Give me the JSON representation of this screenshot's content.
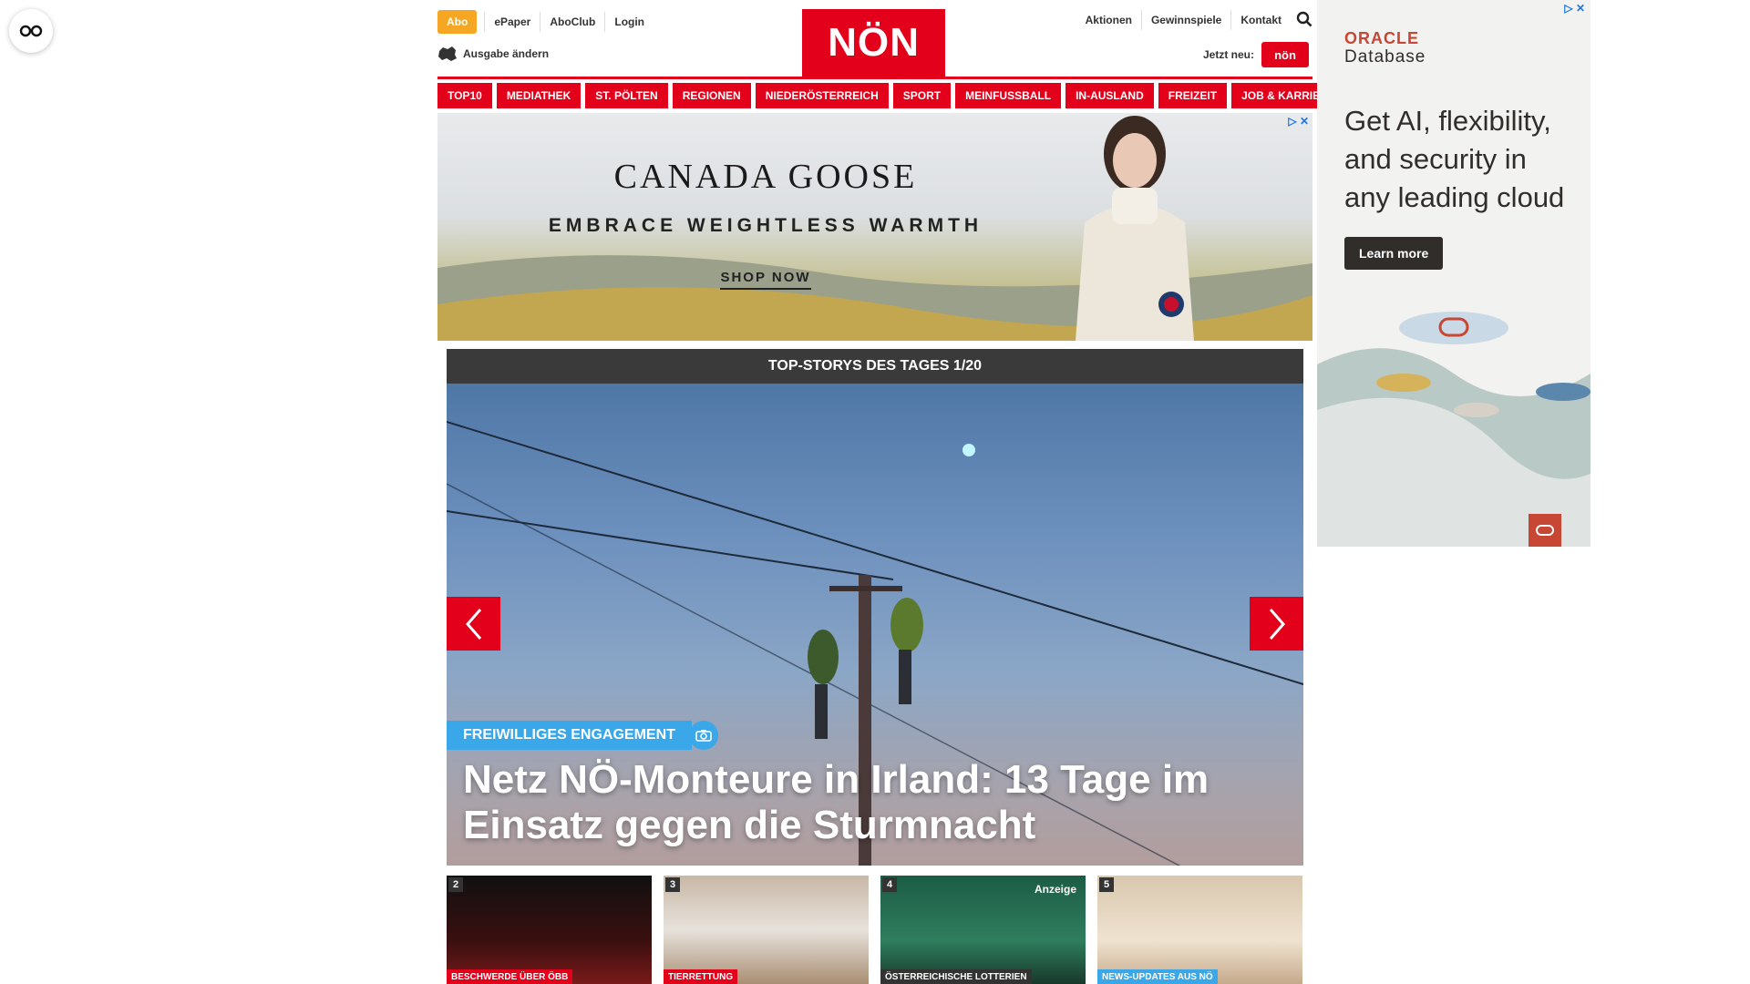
{
  "topbar": {
    "abo": "Abo",
    "links_left": [
      "ePaper",
      "AboClub",
      "Login"
    ],
    "edition": "Ausgabe ändern",
    "logo": "NÖN",
    "links_right": [
      "Aktionen",
      "Gewinnspiele",
      "Kontakt"
    ],
    "new_label": "Jetzt neu:",
    "new_badge": "nön"
  },
  "nav": [
    "TOP10",
    "MEDIATHEK",
    "ST. PÖLTEN",
    "REGIONEN",
    "NIEDERÖSTERREICH",
    "SPORT",
    "MEINFUSSBALL",
    "IN-AUSLAND",
    "FREIZEIT",
    "JOB & KARRIERE"
  ],
  "ad_banner": {
    "brand": "CANADA GOOSE",
    "tagline": "EMBRACE WEIGHTLESS WARMTH",
    "cta": "SHOP NOW"
  },
  "stories": {
    "header": "TOP-STORYS DES TAGES 1/20",
    "category": "FREIWILLIGES ENGAGEMENT",
    "title": "Netz NÖ-Monteure in Irland: 13 Tage im Einsatz gegen die Sturmnacht"
  },
  "thumbs": [
    {
      "num": "2",
      "tag": "BESCHWERDE ÜBER ÖBB",
      "tag_color": "#e2001a"
    },
    {
      "num": "3",
      "tag": "TIERRETTUNG",
      "tag_color": "#e2001a"
    },
    {
      "num": "4",
      "tag": "ÖSTERREICHISCHE LOTTERIEN",
      "tag_color": "#333333",
      "sponsored": "Anzeige"
    },
    {
      "num": "5",
      "tag": "NEWS-UPDATES AUS NÖ",
      "tag_color": "#3aa7e8"
    }
  ],
  "oracle_ad": {
    "brand": "ORACLE",
    "product": "Database",
    "headline": "Get AI, flexibility, and security in any leading cloud",
    "cta": "Learn more"
  },
  "colors": {
    "brand_red": "#e2001a",
    "accent_blue": "#3aa7e8",
    "abo_orange": "#f5a623",
    "oracle_red": "#c74634"
  }
}
